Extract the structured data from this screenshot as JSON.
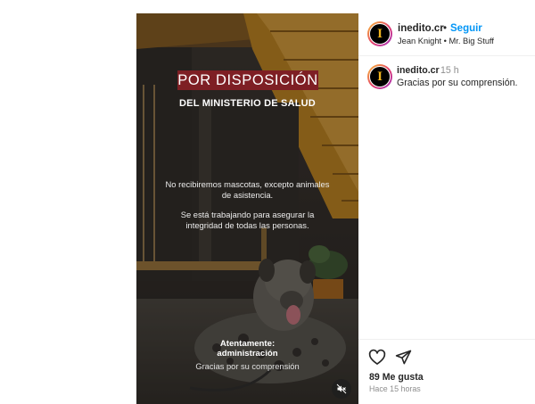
{
  "post": {
    "username": "inedito.cr",
    "follow_label": "Seguir",
    "separator": "•",
    "audio": "Jean Knight • Mr. Big Stuff",
    "avatar_letter": "I",
    "caption_username": "inedito.cr",
    "caption_time": "15 h",
    "caption_text": "Gracias por su comprensión.",
    "likes": "89 Me gusta",
    "posted_ago": "Hace 15 horas"
  },
  "media": {
    "headline": "POR DISPOSICIÓN",
    "subheadline": "DEL MINISTERIO DE SALUD",
    "paragraph1": "No recibiremos mascotas, excepto animales de asistencia.",
    "paragraph2": "Se está trabajando para asegurar la integridad de todas las personas.",
    "signoff_line1": "Atentamente:",
    "signoff_line2": "administración",
    "signoff_thanks": "Gracias por su comprensión",
    "muted": true
  },
  "colors": {
    "link_blue": "#0095f6",
    "headline_bg": "#7e1f24",
    "stair_wood": "#c98a1e",
    "muted_text": "#8e8e8e"
  },
  "icons": [
    "mute-icon",
    "heart-icon",
    "share-icon"
  ]
}
